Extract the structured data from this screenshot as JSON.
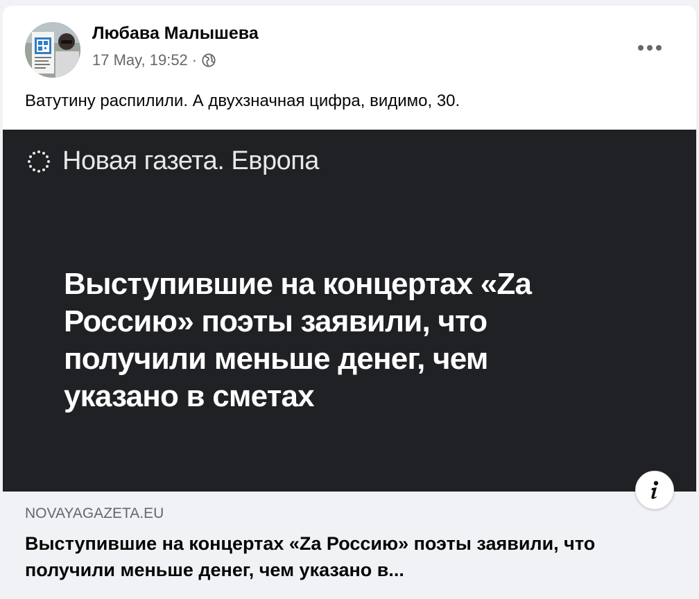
{
  "post": {
    "author": "Любава Малышева",
    "timestamp": "17 May, 19:52",
    "separator": "·",
    "privacy_icon": "globe-icon",
    "menu_icon": "more-dots-icon",
    "text": "Ватутину распилили. А двухзначная цифра, видимо, 30."
  },
  "link_preview": {
    "image": {
      "brand": "Новая газета. Европа",
      "headline_lines": [
        "Выступившие на концертах «Za",
        "Россию» поэты заявили, что",
        "получили меньше денег, чем",
        "указано в сметах"
      ],
      "background": "#202124"
    },
    "info_icon": "info-icon",
    "domain": "NOVAYAGAZETA.EU",
    "title": "Выступившие на концертах «Za Россию» поэты заявили, что получили меньше денег, чем указано в..."
  },
  "colors": {
    "text_primary": "#050505",
    "text_secondary": "#65676b",
    "footer_bg": "#f0f2f5"
  }
}
